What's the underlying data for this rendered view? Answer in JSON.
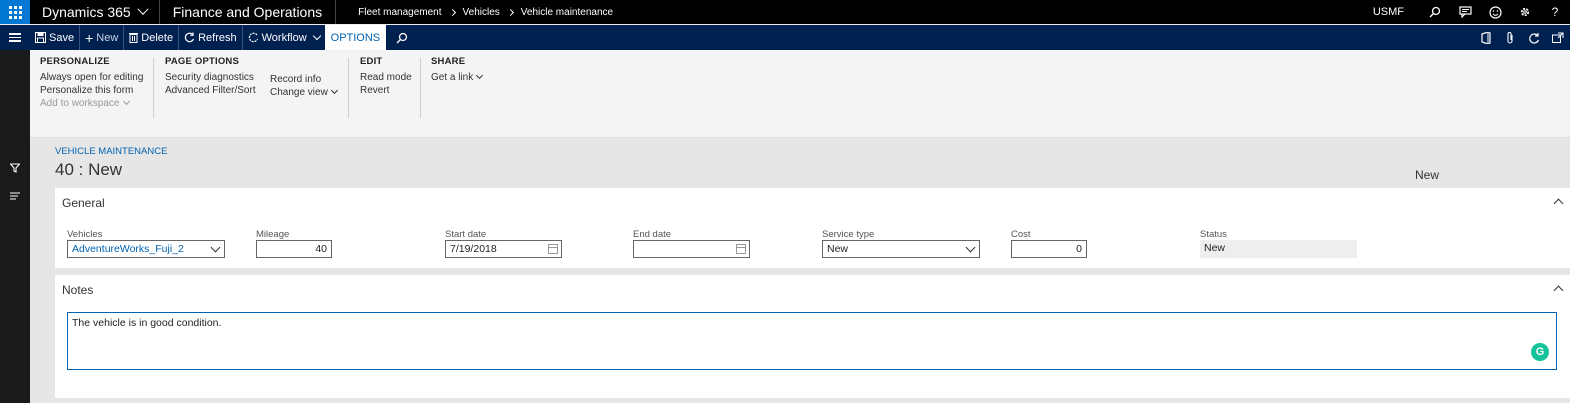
{
  "topbar": {
    "app_name": "Dynamics 365",
    "module_name": "Finance and Operations",
    "breadcrumb": [
      "Fleet management",
      "Vehicles",
      "Vehicle maintenance"
    ],
    "company": "USMF",
    "icons": [
      "search-icon",
      "message-icon",
      "smiley-icon",
      "gear-icon",
      "help-icon"
    ]
  },
  "actionbar": {
    "save": "Save",
    "new": "New",
    "delete": "Delete",
    "refresh": "Refresh",
    "workflow": "Workflow",
    "options": "OPTIONS",
    "right_icons": [
      "office-icon",
      "attach-icon",
      "refresh-icon",
      "popout-icon"
    ]
  },
  "ribbon": {
    "personalize": {
      "title": "PERSONALIZE",
      "items": [
        "Always open for editing",
        "Personalize this form",
        "Add to workspace"
      ]
    },
    "page_options": {
      "title": "PAGE OPTIONS",
      "col1": [
        "Security diagnostics",
        "Advanced Filter/Sort"
      ],
      "col2": [
        "Record info",
        "Change view"
      ]
    },
    "edit": {
      "title": "EDIT",
      "items": [
        "Read mode",
        "Revert"
      ]
    },
    "share": {
      "title": "SHARE",
      "items": [
        "Get a link"
      ]
    }
  },
  "form": {
    "caption": "VEHICLE MAINTENANCE",
    "title": "40 : New",
    "header_status": "New"
  },
  "general": {
    "title": "General",
    "vehicles": {
      "label": "Vehicles",
      "value": "AdventureWorks_Fuji_2"
    },
    "mileage": {
      "label": "Mileage",
      "value": "40"
    },
    "start_date": {
      "label": "Start date",
      "value": "7/19/2018"
    },
    "end_date": {
      "label": "End date",
      "value": ""
    },
    "service_type": {
      "label": "Service type",
      "value": "New"
    },
    "cost": {
      "label": "Cost",
      "value": "0"
    },
    "status": {
      "label": "Status",
      "value": "New"
    }
  },
  "notes": {
    "title": "Notes",
    "value": "The vehicle is in good condition."
  },
  "colors": {
    "topbar": "#000000",
    "actionbar": "#002050",
    "accent": "#0063b1",
    "waffle": "#0078d4",
    "grammarly": "#15c39a"
  }
}
